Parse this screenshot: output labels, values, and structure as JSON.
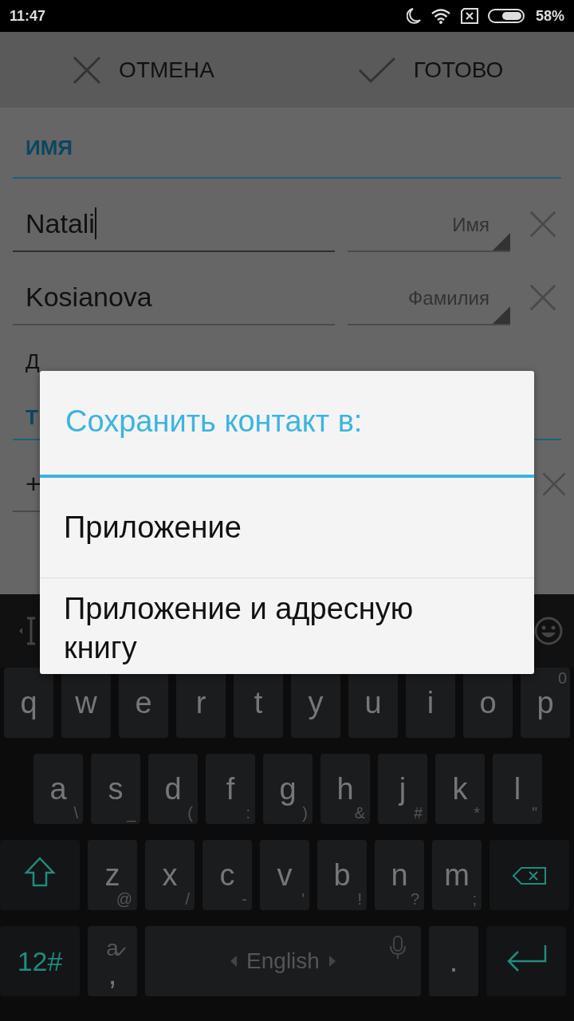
{
  "status_bar": {
    "time": "11:47",
    "battery": "58%"
  },
  "action_bar": {
    "buttons": [
      {
        "kind": "cancel",
        "label": "ОТМЕНА"
      },
      {
        "kind": "done",
        "label": "ГОТОВО"
      }
    ]
  },
  "form": {
    "section": "ИМЯ",
    "fields": [
      {
        "value": "Natali",
        "type_label": "Имя",
        "focused": true
      },
      {
        "value": "Kosianova",
        "type_label": "Фамилия",
        "focused": false
      }
    ],
    "next_label": "Д",
    "phone_section": "Т",
    "phone_value": "+"
  },
  "dialog": {
    "title": "Сохранить контакт в:",
    "options": [
      "Приложение",
      "Приложение и адресную книгу"
    ]
  },
  "keyboard": {
    "rows": [
      {
        "keys": [
          {
            "kind": "letter",
            "label": "q"
          },
          {
            "kind": "letter",
            "label": "w"
          },
          {
            "kind": "letter",
            "label": "e"
          },
          {
            "kind": "letter",
            "label": "r"
          },
          {
            "kind": "letter",
            "label": "t"
          },
          {
            "kind": "letter",
            "label": "y"
          },
          {
            "kind": "letter",
            "label": "u"
          },
          {
            "kind": "letter",
            "label": "i"
          },
          {
            "kind": "letter",
            "label": "o"
          },
          {
            "kind": "letter",
            "label": "p",
            "hint": "0"
          }
        ]
      },
      {
        "keys": [
          {
            "kind": "letter",
            "label": "a",
            "hint": "\\"
          },
          {
            "kind": "letter",
            "label": "s",
            "hint": "_"
          },
          {
            "kind": "letter",
            "label": "d",
            "hint": "("
          },
          {
            "kind": "letter",
            "label": "f",
            "hint": ":"
          },
          {
            "kind": "letter",
            "label": "g",
            "hint": ")"
          },
          {
            "kind": "letter",
            "label": "h",
            "hint": "&"
          },
          {
            "kind": "letter",
            "label": "j",
            "hint": "#"
          },
          {
            "kind": "letter",
            "label": "k",
            "hint": "*"
          },
          {
            "kind": "letter",
            "label": "l",
            "hint": "\""
          }
        ]
      },
      {
        "keys": [
          {
            "kind": "shift"
          },
          {
            "kind": "letter",
            "label": "z",
            "hint": "@"
          },
          {
            "kind": "letter",
            "label": "x",
            "hint": "/"
          },
          {
            "kind": "letter",
            "label": "c",
            "hint": "-"
          },
          {
            "kind": "letter",
            "label": "v",
            "hint": "'"
          },
          {
            "kind": "letter",
            "label": "b",
            "hint": "!"
          },
          {
            "kind": "letter",
            "label": "n",
            "hint": "?"
          },
          {
            "kind": "letter",
            "label": "m",
            "hint": ";"
          },
          {
            "kind": "backspace"
          }
        ]
      },
      {
        "keys": [
          {
            "kind": "symbols",
            "label": "12#"
          },
          {
            "kind": "comma",
            "label": ",",
            "hint": "a"
          },
          {
            "kind": "space",
            "label": "English"
          },
          {
            "kind": "letter",
            "label": "."
          },
          {
            "kind": "enter"
          }
        ]
      }
    ]
  }
}
